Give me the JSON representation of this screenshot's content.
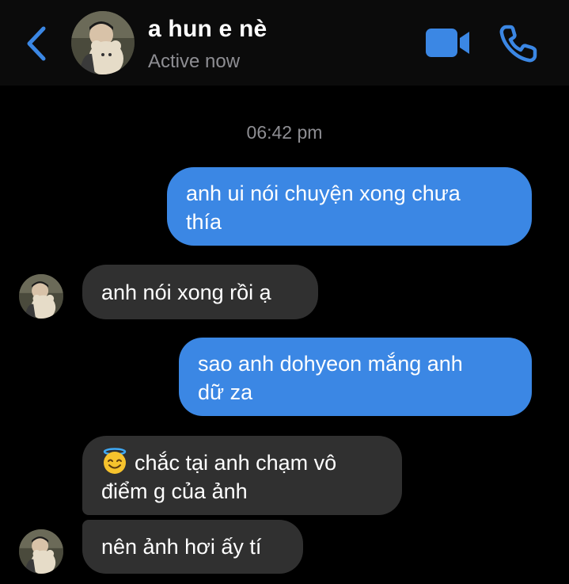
{
  "header": {
    "contact_name": "a hun e nè",
    "status": "Active now",
    "back_icon": "chevron-left-icon",
    "video_icon": "video-camera-icon",
    "phone_icon": "phone-icon",
    "accent_color": "#3b87e4"
  },
  "conversation": {
    "timestamp": "06:42 pm",
    "messages": [
      {
        "direction": "outgoing",
        "line1": "anh ui nói chuyện xong chưa",
        "line2": "thía"
      },
      {
        "direction": "incoming",
        "text": "anh nói xong rồi ạ"
      },
      {
        "direction": "outgoing",
        "line1": "sao anh dohyeon mắng anh",
        "line2": "dữ za"
      },
      {
        "direction": "incoming",
        "line1": "chắc tại anh chạm vô",
        "line2": "điểm g của ảnh",
        "emoji": "smiling-face-with-halo"
      },
      {
        "direction": "incoming",
        "text": "nên ảnh hơi ấy tí"
      }
    ],
    "outgoing_color": "#3b87e4",
    "incoming_color": "#303030"
  }
}
